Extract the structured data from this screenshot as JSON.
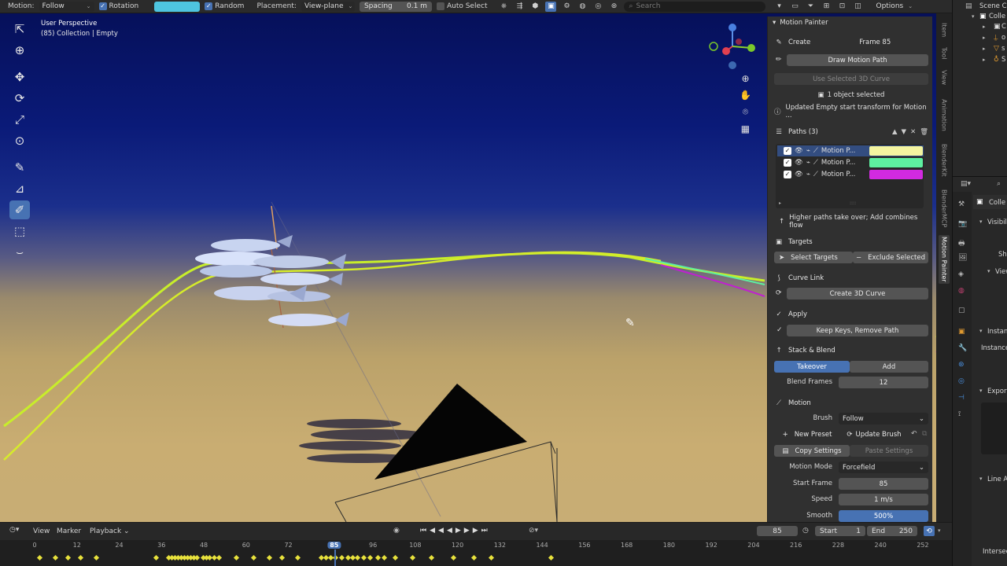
{
  "header": {
    "motion_label": "Motion:",
    "motion_value": "Follow",
    "rotation_label": "Rotation",
    "color_swatch": "#4ec5e0",
    "random_label": "Random",
    "placement_label": "Placement:",
    "placement_value": "View-plane",
    "spacing_label": "Spacing",
    "spacing_value": "0.1 m",
    "auto_select_label": "Auto Select",
    "search_placeholder": "Search",
    "options_label": "Options"
  },
  "viewport": {
    "title": "User Perspective",
    "subtitle": "(85) Collection | Empty"
  },
  "panel": {
    "title": "Motion Painter",
    "create_label": "Create",
    "frame_label": "Frame 85",
    "draw_motion_path": "Draw Motion Path",
    "use_selected_curve": "Use Selected 3D Curve",
    "objects_selected": "1 object selected",
    "status_message": "Updated Empty start transform for Motion ...",
    "paths_header": "Paths (3)",
    "paths": [
      {
        "name": "Motion P...",
        "color": "#f4f5a0",
        "selected": true
      },
      {
        "name": "Motion P...",
        "color": "#5ef0a0",
        "selected": false
      },
      {
        "name": "Motion P...",
        "color": "#d22ae0",
        "selected": false
      }
    ],
    "hint": "Higher paths take over; Add combines flow",
    "targets_header": "Targets",
    "select_targets": "Select Targets",
    "exclude_selected": "Exclude Selected",
    "curve_link_header": "Curve Link",
    "create_3d_curve": "Create 3D Curve",
    "apply_header": "Apply",
    "keep_keys": "Keep Keys, Remove Path",
    "stack_header": "Stack & Blend",
    "takeover": "Takeover",
    "add": "Add",
    "blend_frames_label": "Blend Frames",
    "blend_frames_value": "12",
    "motion_header": "Motion",
    "brush_label": "Brush",
    "brush_value": "Follow",
    "new_preset": "New Preset",
    "update_brush": "Update Brush",
    "copy_settings": "Copy Settings",
    "paste_settings": "Paste Settings",
    "motion_mode_label": "Motion Mode",
    "motion_mode_value": "Forcefield",
    "start_frame_label": "Start Frame",
    "start_frame_value": "85",
    "speed_label": "Speed",
    "speed_value": "1 m/s",
    "smooth_label": "Smooth",
    "smooth_value": "500%"
  },
  "vtabs": [
    "Item",
    "Tool",
    "View",
    "Animation",
    "BlenderKit",
    "BlenderMCP",
    "Motion Painter"
  ],
  "outliner": {
    "scene_label": "Scene Co",
    "collection_label": "Colle",
    "items": [
      "C",
      "o",
      "s",
      "S"
    ]
  },
  "properties": {
    "collection_label": "Colle",
    "visibility_label": "Visibil",
    "s_label": "Sh",
    "view_label": "View",
    "instance_label": "Instan",
    "instance_sub": "Instance",
    "export_label": "Export",
    "line_art_label": "Line A",
    "intersect_label": "Intersec"
  },
  "timeline": {
    "view_label": "View",
    "marker_label": "Marker",
    "playback_label": "Playback",
    "current_frame": "85",
    "start_label": "Start",
    "start_value": "1",
    "end_label": "End",
    "end_value": "250",
    "ticks": [
      "0",
      "12",
      "24",
      "36",
      "48",
      "60",
      "72",
      "85",
      "96",
      "108",
      "120",
      "132",
      "144",
      "156",
      "168",
      "180",
      "192",
      "204",
      "216",
      "228",
      "240",
      "252"
    ]
  }
}
